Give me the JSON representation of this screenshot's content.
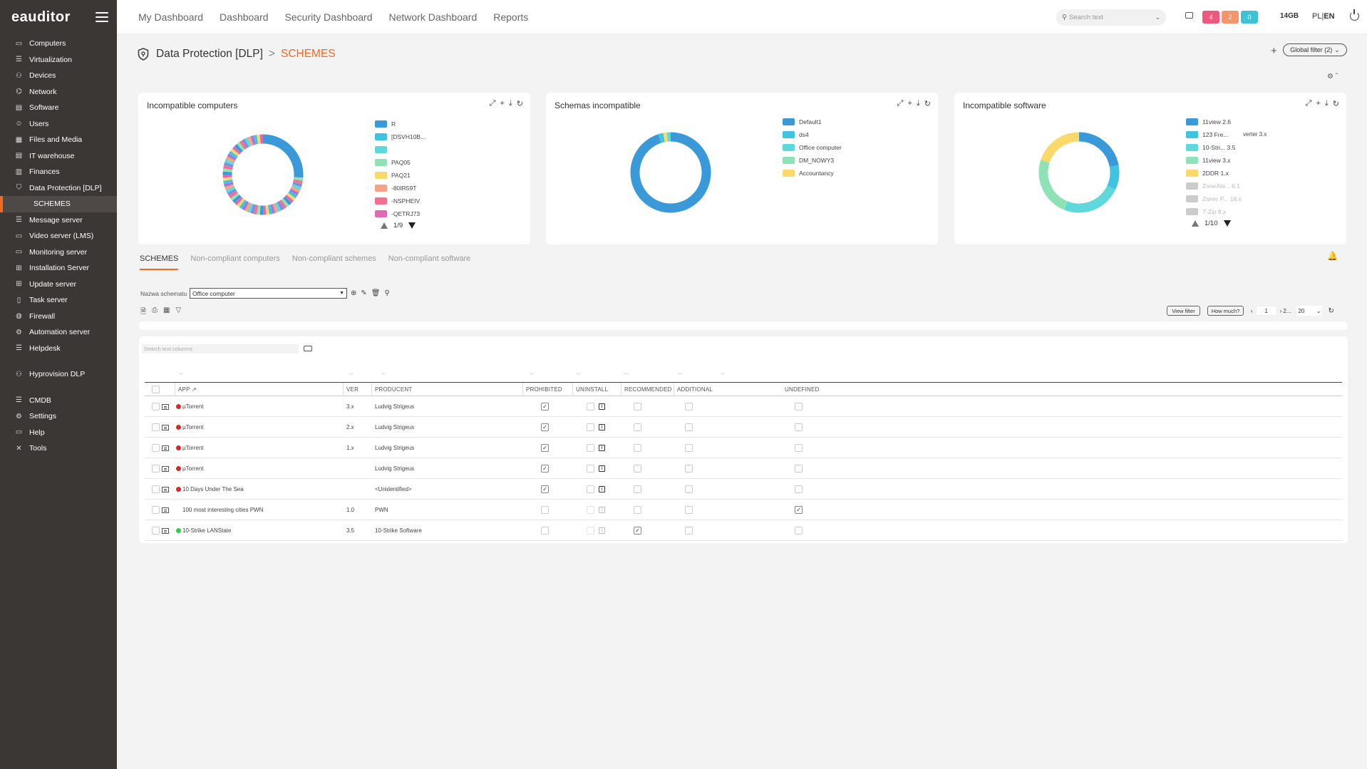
{
  "app": {
    "logo": "eauditor"
  },
  "sidebar": {
    "items": [
      {
        "label": "Computers",
        "icon": "monitor-icon"
      },
      {
        "label": "Virtualization",
        "icon": "server-icon"
      },
      {
        "label": "Devices",
        "icon": "devices-icon"
      },
      {
        "label": "Network",
        "icon": "network-icon"
      },
      {
        "label": "Software",
        "icon": "software-icon"
      },
      {
        "label": "Users",
        "icon": "users-icon"
      },
      {
        "label": "Files and Media",
        "icon": "files-icon"
      },
      {
        "label": "IT warehouse",
        "icon": "warehouse-icon"
      },
      {
        "label": "Finances",
        "icon": "finances-icon"
      },
      {
        "label": "Data Protection [DLP]",
        "icon": "shield-icon"
      },
      {
        "label": "SCHEMES",
        "icon": "",
        "sub": true
      },
      {
        "label": "Message server",
        "icon": "message-icon"
      },
      {
        "label": "Video server (LMS)",
        "icon": "video-icon"
      },
      {
        "label": "Monitoring server",
        "icon": "monitoring-icon"
      },
      {
        "label": "Installation Server",
        "icon": "installation-icon"
      },
      {
        "label": "Update server",
        "icon": "update-icon"
      },
      {
        "label": "Task server",
        "icon": "task-icon"
      },
      {
        "label": "Firewall",
        "icon": "firewall-icon"
      },
      {
        "label": "Automation server",
        "icon": "automation-icon"
      },
      {
        "label": "Helpdesk",
        "icon": "helpdesk-icon"
      }
    ],
    "items2": [
      {
        "label": "Hyprovision DLP",
        "icon": "hyprovision-icon"
      }
    ],
    "items3": [
      {
        "label": "CMDB",
        "icon": "cmdb-icon"
      },
      {
        "label": "Settings",
        "icon": "gear-icon"
      },
      {
        "label": "Help",
        "icon": "help-icon"
      },
      {
        "label": "Tools",
        "icon": "tools-icon"
      }
    ]
  },
  "topnav": {
    "links": [
      "My Dashboard",
      "Dashboard",
      "Security Dashboard",
      "Network Dashboard",
      "Reports"
    ],
    "search_placeholder": "Search text",
    "badges": [
      {
        "value": "4",
        "color": "#f0577f"
      },
      {
        "value": "2",
        "color": "#f4956b"
      },
      {
        "value": "0",
        "color": "#3ec3d6"
      }
    ],
    "disk": "14GB",
    "lang_pl": "PL",
    "lang_sep": "|",
    "lang_en": "EN"
  },
  "breadcrumb": {
    "section": "Data Protection [DLP]",
    "separator": ">",
    "page": "SCHEMES"
  },
  "global_filter": "Global filter (2)",
  "charts": [
    {
      "title": "Incompatible computers",
      "legend": [
        {
          "label": "R",
          "color": "#3a9ad9"
        },
        {
          "label": "[DSVH10B...",
          "color": "#3ec3e0"
        },
        {
          "label": "",
          "color": "#5fd8dc"
        },
        {
          "label": "PAQ05",
          "color": "#8ee2b5"
        },
        {
          "label": "PAQ21",
          "color": "#fbd86a"
        },
        {
          "label": "-80IR59T",
          "color": "#f5a285"
        },
        {
          "label": "-NSPHEIV",
          "color": "#f27193"
        },
        {
          "label": "-QETRJ73",
          "color": "#e068b7"
        }
      ],
      "pager": "1/9"
    },
    {
      "title": "Schemas incompatible",
      "legend": [
        {
          "label": "Default1",
          "color": "#3a9ad9"
        },
        {
          "label": "ds4",
          "color": "#3ec3e0"
        },
        {
          "label": "Office computer",
          "color": "#5fd8dc"
        },
        {
          "label": "DM_NOWY3",
          "color": "#8ee2b5"
        },
        {
          "label": "Accountancy",
          "color": "#fbd86a"
        }
      ]
    },
    {
      "title": "Incompatible software",
      "legend": [
        {
          "label": "11view 2.6",
          "color": "#3a9ad9"
        },
        {
          "label": "123 Fre...",
          "color": "#3ec3e0"
        },
        {
          "label": "10-Stri... 3.5",
          "color": "#5fd8dc"
        },
        {
          "label": "11view 3.x",
          "color": "#8ee2b5"
        },
        {
          "label": "2DDR 1.x",
          "color": "#fbd86a"
        },
        {
          "label": "ZoneAla... 6.1",
          "color": "#cccccc",
          "faded": true
        },
        {
          "label": "Zoner P... 16.x",
          "color": "#cccccc",
          "faded": true
        },
        {
          "label": "7-Zip 9.x",
          "color": "#cccccc",
          "faded": true
        }
      ],
      "extra_label": "verter 3.x",
      "pager": "1/10"
    }
  ],
  "tabs": [
    "SCHEMES",
    "Non-compliant computers",
    "Non-compliant schemes",
    "Non-compliant software"
  ],
  "schema": {
    "label": "Nazwa schematu",
    "value": "Office computer"
  },
  "toolbar": {
    "view_filter": "View filter",
    "how_much": "How much?",
    "page": "1",
    "pages": "2...",
    "per_page": "20"
  },
  "table": {
    "search_placeholder": "Search text columns",
    "columns": [
      "APP",
      "VER",
      "PRODUCENT",
      "PROHIBITED",
      "UNINSTALL",
      "RECOMMENDED",
      "ADDITIONAL",
      "UNDEFINED"
    ],
    "sort_indicator": "↗",
    "rows": [
      {
        "dot": "red",
        "app": "µTorrent",
        "ver": "3.x",
        "producer": "Ludvig Strigeus",
        "prohibited": true,
        "uninstall": true,
        "recommended": false,
        "additional": false,
        "undefined": false
      },
      {
        "dot": "red",
        "app": "µTorrent",
        "ver": "2.x",
        "producer": "Ludvig Strigeus",
        "prohibited": true,
        "uninstall": true,
        "recommended": false,
        "additional": false,
        "undefined": false
      },
      {
        "dot": "red",
        "app": "µTorrent",
        "ver": "1.x",
        "producer": "Ludvig Strigeus",
        "prohibited": true,
        "uninstall": true,
        "recommended": false,
        "additional": false,
        "undefined": false
      },
      {
        "dot": "red",
        "app": "µTorrent",
        "ver": "",
        "producer": "Ludvig Strigeus",
        "prohibited": true,
        "uninstall": true,
        "recommended": false,
        "additional": false,
        "undefined": false
      },
      {
        "dot": "red",
        "app": "10 Days Under The Sea",
        "ver": "",
        "producer": "<Unidentified>",
        "prohibited": true,
        "uninstall": true,
        "recommended": false,
        "additional": false,
        "undefined": false
      },
      {
        "dot": "none",
        "app": "100 most interesting cities PWN",
        "ver": "1.0",
        "producer": "PWN",
        "prohibited": false,
        "uninstall": false,
        "recommended": false,
        "additional": false,
        "undefined": true
      },
      {
        "dot": "green",
        "app": "10-Strike LANState",
        "ver": "3.5",
        "producer": "10-Strike Software",
        "prohibited": false,
        "uninstall": false,
        "recommended": true,
        "additional": false,
        "undefined": false
      }
    ]
  }
}
